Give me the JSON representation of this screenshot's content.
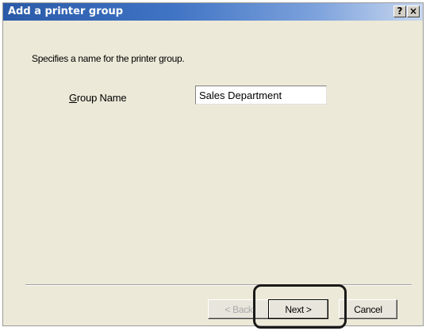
{
  "window": {
    "title": "Add a printer group",
    "help_label": "?",
    "close_label": "×"
  },
  "content": {
    "description": "Specifies a name for the printer group.",
    "group_name_accesskey": "G",
    "group_name_rest": "roup Name",
    "group_name_value": "Sales Department"
  },
  "buttons": {
    "back_label": "< Back",
    "next_label": "Next >",
    "cancel_label": "Cancel"
  }
}
